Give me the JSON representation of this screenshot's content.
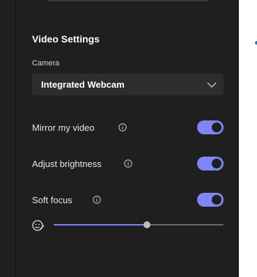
{
  "video_settings": {
    "title": "Video Settings",
    "camera": {
      "label": "Camera",
      "selected": "Integrated Webcam"
    },
    "toggles": [
      {
        "label": "Mirror my video",
        "on": true
      },
      {
        "label": "Adjust brightness",
        "on": true
      },
      {
        "label": "Soft focus",
        "on": true
      }
    ],
    "soft_focus_level": 0.55
  },
  "colors": {
    "panel_bg": "#1f1f1f",
    "accent": "#7f85f5",
    "dropdown_bg": "#2d2d2d"
  },
  "icons": {
    "info": "info-circle-icon",
    "dropdown": "chevron-down-icon",
    "soft_focus": "face-retouch-icon"
  }
}
